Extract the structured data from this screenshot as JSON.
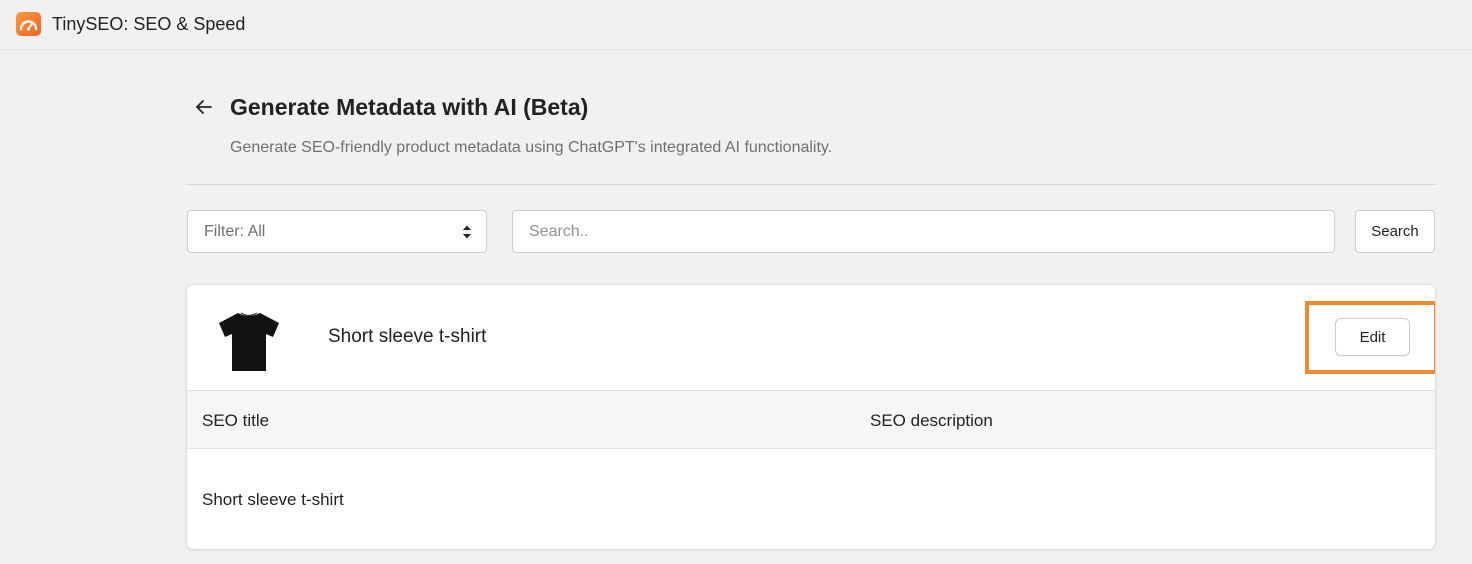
{
  "app": {
    "title": "TinySEO: SEO & Speed",
    "icon": "speedometer-icon",
    "accent_color": "#f26322"
  },
  "page": {
    "title": "Generate Metadata with AI (Beta)",
    "subtitle": "Generate SEO-friendly product metadata using ChatGPT's integrated AI functionality.",
    "back_icon": "arrow-left-icon"
  },
  "filters": {
    "filter_label": "Filter: All",
    "search_placeholder": "Search..",
    "search_value": "",
    "search_button": "Search"
  },
  "product": {
    "name": "Short sleeve t-shirt",
    "image_icon": "tshirt-image",
    "edit_label": "Edit",
    "highlight_color": "#f0892f"
  },
  "table": {
    "columns": [
      "SEO title",
      "SEO description"
    ],
    "rows": [
      {
        "seo_title": "Short sleeve t-shirt",
        "seo_description": ""
      }
    ]
  }
}
